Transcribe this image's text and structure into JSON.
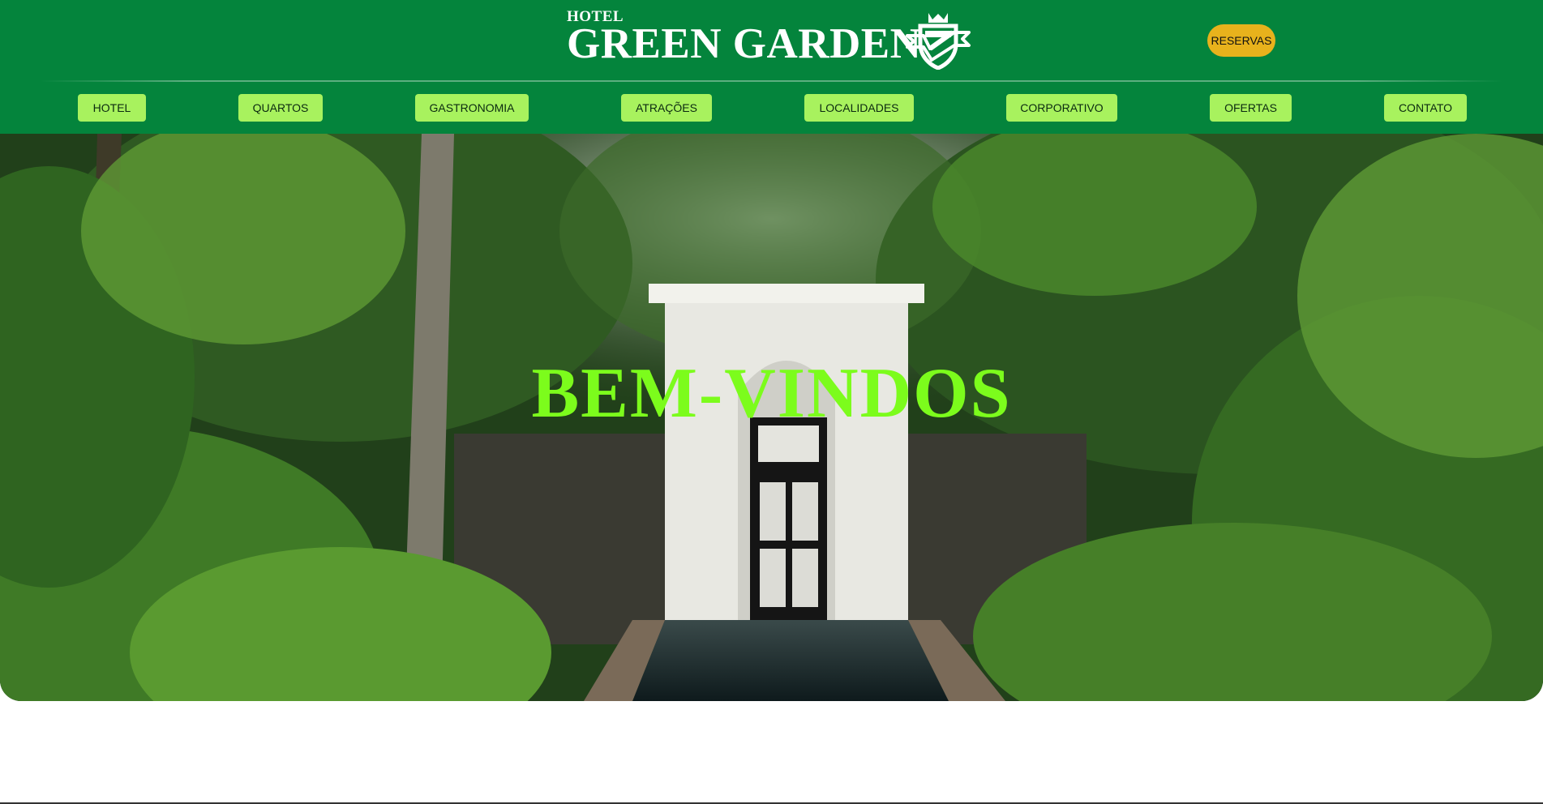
{
  "header": {
    "logo_small": "HOTEL",
    "logo_big": "GREEN GARDEN",
    "logo_crest_icon": "shield-crown-icon",
    "reservas_label": "RESERVAS",
    "colors": {
      "header_bg": "#04843c",
      "nav_bg": "#a8f25e",
      "reservas_bg": "#e8b21c"
    }
  },
  "nav": {
    "items": [
      {
        "label": "HOTEL"
      },
      {
        "label": "QUARTOS"
      },
      {
        "label": "GASTRONOMIA"
      },
      {
        "label": "ATRAÇÕES"
      },
      {
        "label": "LOCALIDADES"
      },
      {
        "label": "CORPORATIVO"
      },
      {
        "label": "OFERTAS"
      },
      {
        "label": "CONTATO"
      }
    ]
  },
  "hero": {
    "title": "BEM-VINDOS",
    "title_color": "#7cfc1c"
  }
}
